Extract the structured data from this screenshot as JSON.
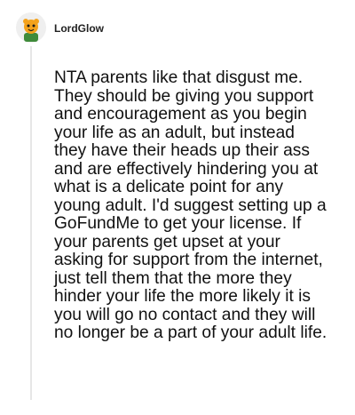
{
  "post": {
    "author": {
      "username": "LordGlow",
      "avatar_icon": "snoo-tiger-avatar-icon"
    },
    "body": "NTA parents like that disgust me. They should be giving you support and encouragement as you begin your life as an adult, but instead they have their heads up their ass and are effectively hindering you at what is a delicate point for any young adult. I'd suggest setting up a GoFundMe to get your license. If your parents get upset at your asking for support from the internet, just tell them that the more they hinder your life the more likely it is you will go no contact and they will no longer be a part of your adult life."
  },
  "colors": {
    "thread_line": "#e6e6e6",
    "avatar_accent": "#f4a21c",
    "avatar_shirt": "#3f8b3a"
  }
}
